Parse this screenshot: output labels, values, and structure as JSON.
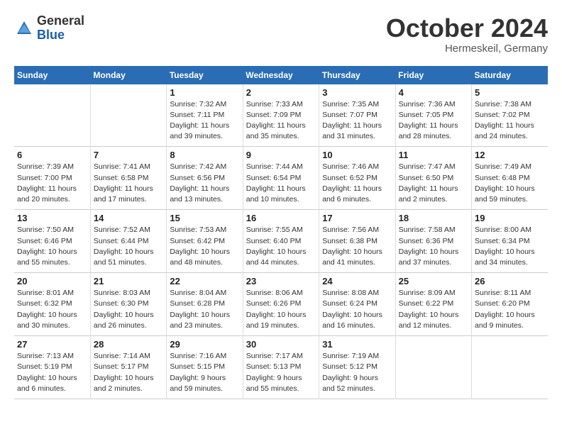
{
  "header": {
    "logo_general": "General",
    "logo_blue": "Blue",
    "month": "October 2024",
    "location": "Hermeskeil, Germany"
  },
  "weekdays": [
    "Sunday",
    "Monday",
    "Tuesday",
    "Wednesday",
    "Thursday",
    "Friday",
    "Saturday"
  ],
  "weeks": [
    [
      {
        "day": "",
        "info": ""
      },
      {
        "day": "",
        "info": ""
      },
      {
        "day": "1",
        "info": "Sunrise: 7:32 AM\nSunset: 7:11 PM\nDaylight: 11 hours and 39 minutes."
      },
      {
        "day": "2",
        "info": "Sunrise: 7:33 AM\nSunset: 7:09 PM\nDaylight: 11 hours and 35 minutes."
      },
      {
        "day": "3",
        "info": "Sunrise: 7:35 AM\nSunset: 7:07 PM\nDaylight: 11 hours and 31 minutes."
      },
      {
        "day": "4",
        "info": "Sunrise: 7:36 AM\nSunset: 7:05 PM\nDaylight: 11 hours and 28 minutes."
      },
      {
        "day": "5",
        "info": "Sunrise: 7:38 AM\nSunset: 7:02 PM\nDaylight: 11 hours and 24 minutes."
      }
    ],
    [
      {
        "day": "6",
        "info": "Sunrise: 7:39 AM\nSunset: 7:00 PM\nDaylight: 11 hours and 20 minutes."
      },
      {
        "day": "7",
        "info": "Sunrise: 7:41 AM\nSunset: 6:58 PM\nDaylight: 11 hours and 17 minutes."
      },
      {
        "day": "8",
        "info": "Sunrise: 7:42 AM\nSunset: 6:56 PM\nDaylight: 11 hours and 13 minutes."
      },
      {
        "day": "9",
        "info": "Sunrise: 7:44 AM\nSunset: 6:54 PM\nDaylight: 11 hours and 10 minutes."
      },
      {
        "day": "10",
        "info": "Sunrise: 7:46 AM\nSunset: 6:52 PM\nDaylight: 11 hours and 6 minutes."
      },
      {
        "day": "11",
        "info": "Sunrise: 7:47 AM\nSunset: 6:50 PM\nDaylight: 11 hours and 2 minutes."
      },
      {
        "day": "12",
        "info": "Sunrise: 7:49 AM\nSunset: 6:48 PM\nDaylight: 10 hours and 59 minutes."
      }
    ],
    [
      {
        "day": "13",
        "info": "Sunrise: 7:50 AM\nSunset: 6:46 PM\nDaylight: 10 hours and 55 minutes."
      },
      {
        "day": "14",
        "info": "Sunrise: 7:52 AM\nSunset: 6:44 PM\nDaylight: 10 hours and 51 minutes."
      },
      {
        "day": "15",
        "info": "Sunrise: 7:53 AM\nSunset: 6:42 PM\nDaylight: 10 hours and 48 minutes."
      },
      {
        "day": "16",
        "info": "Sunrise: 7:55 AM\nSunset: 6:40 PM\nDaylight: 10 hours and 44 minutes."
      },
      {
        "day": "17",
        "info": "Sunrise: 7:56 AM\nSunset: 6:38 PM\nDaylight: 10 hours and 41 minutes."
      },
      {
        "day": "18",
        "info": "Sunrise: 7:58 AM\nSunset: 6:36 PM\nDaylight: 10 hours and 37 minutes."
      },
      {
        "day": "19",
        "info": "Sunrise: 8:00 AM\nSunset: 6:34 PM\nDaylight: 10 hours and 34 minutes."
      }
    ],
    [
      {
        "day": "20",
        "info": "Sunrise: 8:01 AM\nSunset: 6:32 PM\nDaylight: 10 hours and 30 minutes."
      },
      {
        "day": "21",
        "info": "Sunrise: 8:03 AM\nSunset: 6:30 PM\nDaylight: 10 hours and 26 minutes."
      },
      {
        "day": "22",
        "info": "Sunrise: 8:04 AM\nSunset: 6:28 PM\nDaylight: 10 hours and 23 minutes."
      },
      {
        "day": "23",
        "info": "Sunrise: 8:06 AM\nSunset: 6:26 PM\nDaylight: 10 hours and 19 minutes."
      },
      {
        "day": "24",
        "info": "Sunrise: 8:08 AM\nSunset: 6:24 PM\nDaylight: 10 hours and 16 minutes."
      },
      {
        "day": "25",
        "info": "Sunrise: 8:09 AM\nSunset: 6:22 PM\nDaylight: 10 hours and 12 minutes."
      },
      {
        "day": "26",
        "info": "Sunrise: 8:11 AM\nSunset: 6:20 PM\nDaylight: 10 hours and 9 minutes."
      }
    ],
    [
      {
        "day": "27",
        "info": "Sunrise: 7:13 AM\nSunset: 5:19 PM\nDaylight: 10 hours and 6 minutes."
      },
      {
        "day": "28",
        "info": "Sunrise: 7:14 AM\nSunset: 5:17 PM\nDaylight: 10 hours and 2 minutes."
      },
      {
        "day": "29",
        "info": "Sunrise: 7:16 AM\nSunset: 5:15 PM\nDaylight: 9 hours and 59 minutes."
      },
      {
        "day": "30",
        "info": "Sunrise: 7:17 AM\nSunset: 5:13 PM\nDaylight: 9 hours and 55 minutes."
      },
      {
        "day": "31",
        "info": "Sunrise: 7:19 AM\nSunset: 5:12 PM\nDaylight: 9 hours and 52 minutes."
      },
      {
        "day": "",
        "info": ""
      },
      {
        "day": "",
        "info": ""
      }
    ]
  ]
}
